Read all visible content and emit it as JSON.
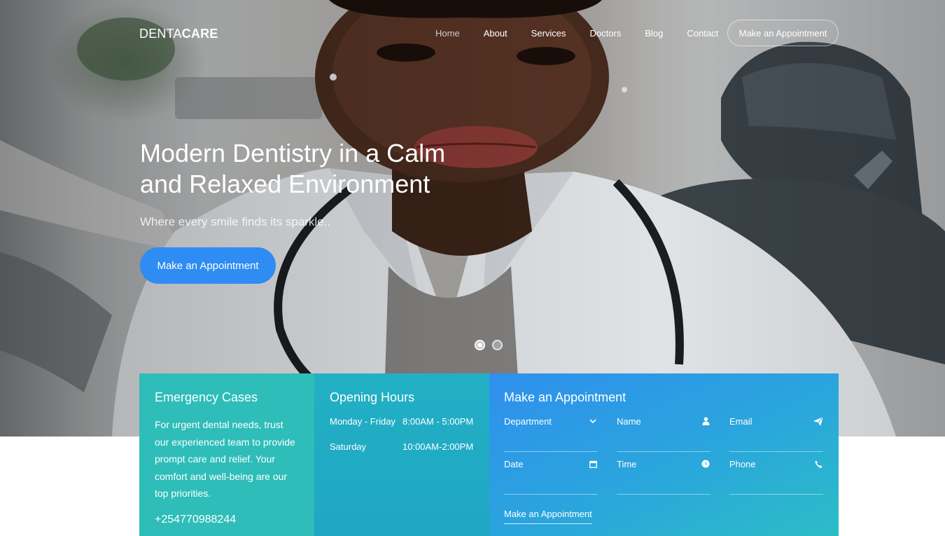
{
  "brand": {
    "name_light": "DENTA",
    "name_bold": "CARE"
  },
  "nav": {
    "items": [
      {
        "label": "Home",
        "active": true
      },
      {
        "label": "About"
      },
      {
        "label": "Services"
      },
      {
        "label": "Doctors"
      },
      {
        "label": "Blog"
      },
      {
        "label": "Contact"
      }
    ],
    "cta_label": "Make an Appointment"
  },
  "hero": {
    "title": "Modern Dentistry in a Calm and Relaxed Environment",
    "subtitle": "Where every smile finds its sparkle..",
    "cta_label": "Make an Appointment",
    "slides": 2,
    "active_slide": 1
  },
  "emergency": {
    "title": "Emergency Cases",
    "text": "For urgent dental needs, trust our experienced team to provide prompt care and relief. Your comfort and well-being are our top priorities.",
    "phone": "+254770988244"
  },
  "hours": {
    "title": "Opening Hours",
    "rows": [
      {
        "days": "Monday - Friday",
        "time": "8:00AM - 5:00PM"
      },
      {
        "days": "Saturday",
        "time": "10:00AM-2:00PM"
      }
    ]
  },
  "appointment": {
    "title": "Make an Appointment",
    "fields": [
      {
        "label": "Department",
        "icon": "chevron-down-icon"
      },
      {
        "label": "Name",
        "icon": "user-icon"
      },
      {
        "label": "Email",
        "icon": "paper-plane-icon"
      },
      {
        "label": "Date",
        "icon": "calendar-icon"
      },
      {
        "label": "Time",
        "icon": "clock-icon"
      },
      {
        "label": "Phone",
        "icon": "phone-icon"
      }
    ],
    "submit_label": "Make an Appointment"
  },
  "colors": {
    "primary": "#2f8cf2",
    "teal": "#2ebdb8",
    "cyan": "#22b0c4"
  }
}
